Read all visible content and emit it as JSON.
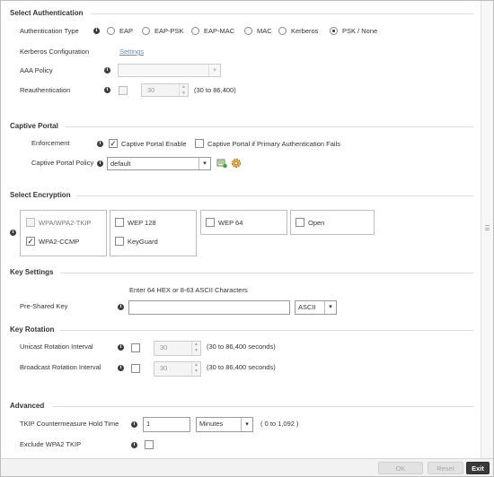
{
  "select_auth": {
    "title": "Select Authentication",
    "auth_type_label": "Authentication Type",
    "auth_options": [
      "EAP",
      "EAP-PSK",
      "EAP-MAC",
      "MAC",
      "Kerberos",
      "PSK / None"
    ],
    "auth_selected": "PSK / None",
    "kerberos_label": "Kerberos Configuration",
    "kerberos_link": "Settings",
    "aaa_label": "AAA Policy",
    "aaa_value": "",
    "reauth_label": "Reauthentication",
    "reauth_checked": false,
    "reauth_value": "30",
    "reauth_range": "(30 to 86,400)"
  },
  "captive_portal": {
    "title": "Captive Portal",
    "enforcement_label": "Enforcement",
    "enable_label": "Captive Portal Enable",
    "enable_checked": true,
    "if_fails_label": "Captive Portal if Primary Authentication Fails",
    "if_fails_checked": false,
    "policy_label": "Captive Portal Policy",
    "policy_value": "default"
  },
  "encryption": {
    "title": "Select Encryption",
    "options": {
      "wpa_tkip": {
        "label": "WPA/WPA2-TKIP",
        "checked": false,
        "enabled": false
      },
      "wpa2_ccmp": {
        "label": "WPA2-CCMP",
        "checked": true,
        "enabled": true
      },
      "wep128": {
        "label": "WEP 128",
        "checked": false,
        "enabled": true
      },
      "keyguard": {
        "label": "KeyGuard",
        "checked": false,
        "enabled": true
      },
      "wep64": {
        "label": "WEP 64",
        "checked": false,
        "enabled": true
      },
      "open": {
        "label": "Open",
        "checked": false,
        "enabled": true
      }
    }
  },
  "key_settings": {
    "title": "Key Settings",
    "hint": "Enter 64 HEX or 8-63 ASCII Characters",
    "psk_label": "Pre-Shared Key",
    "psk_value": "",
    "format_value": "ASCII"
  },
  "key_rotation": {
    "title": "Key Rotation",
    "unicast_label": "Unicast Rotation Interval",
    "unicast_checked": false,
    "unicast_value": "30",
    "unicast_range": "(30 to 86,400 seconds)",
    "broadcast_label": "Broadcast Rotation Interval",
    "broadcast_checked": false,
    "broadcast_value": "30",
    "broadcast_range": "(30 to 86,400 seconds)"
  },
  "advanced": {
    "title": "Advanced",
    "tkip_label": "TKIP Countermeasure Hold Time",
    "tkip_value": "1",
    "tkip_unit": "Minutes",
    "tkip_range": "( 0 to 1,092 )",
    "exclude_label": "Exclude WPA2 TKIP",
    "exclude_checked": false
  },
  "footer": {
    "ok": "OK",
    "reset": "Reset",
    "exit": "Exit"
  },
  "colors": {
    "link": "#6a8caf",
    "exit_bg": "#3a3a3a",
    "section_line": "#dcdcdc"
  }
}
